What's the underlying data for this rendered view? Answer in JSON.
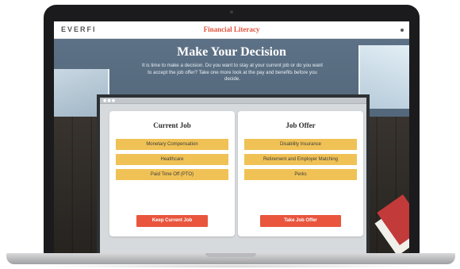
{
  "app": {
    "brand": "EVERFI",
    "module_title": "Financial Literacy"
  },
  "lesson": {
    "heading": "Make Your Decision",
    "intro": "It is time to make a decision. Do you want to stay at your current job or do you want to accept the job offer? Take one more look at the pay and benefits before you decide."
  },
  "current_job": {
    "title": "Current Job",
    "items": [
      "Monetary Compensation",
      "Healthcare",
      "Paid Time Off (PTO)"
    ],
    "button": "Keep Current Job"
  },
  "job_offer": {
    "title": "Job Offer",
    "items": [
      "Disability Insurance",
      "Retirement and Employer Matching",
      "Perks"
    ],
    "button": "Take Job Offer"
  },
  "colors": {
    "accent": "#e9553d",
    "item_fill": "#f0c256",
    "title_red": "#e0523a"
  }
}
